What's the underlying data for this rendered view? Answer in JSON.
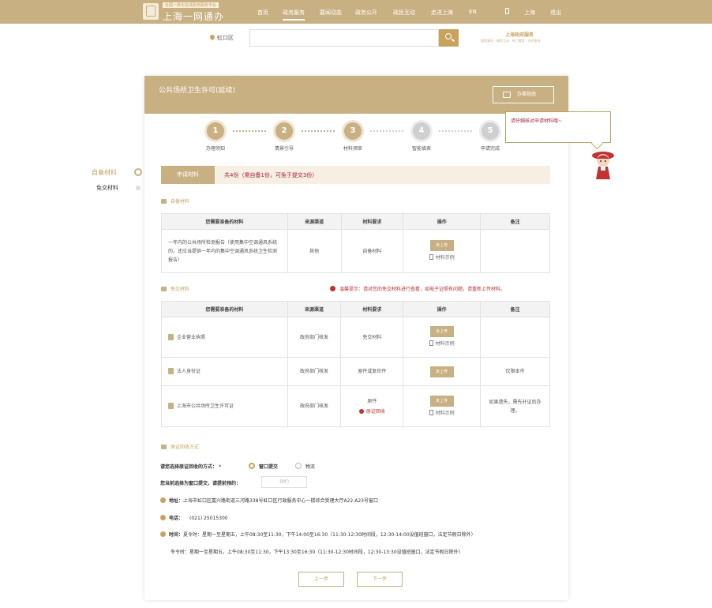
{
  "header": {
    "logo_sub": "全国一体化在线政务服务平台",
    "logo_title": "上海一网通办",
    "nav": [
      "首页",
      "政务服务",
      "要闻动态",
      "政务公开",
      "政民互动",
      "走进上海",
      "EN"
    ],
    "city": "上海",
    "exit": "退出"
  },
  "search": {
    "district": "虹口区",
    "placeholder": "",
    "brand_title": "上海政府服务",
    "brand_links": "搜索事项 · 政民互动 · 热门搜索 · 办件查询"
  },
  "page": {
    "title": "公共场所卫生许可(延续)",
    "guide_label": "办事指南"
  },
  "steps": [
    {
      "num": "1",
      "label": "办理须知",
      "active": true
    },
    {
      "num": "2",
      "label": "情景引导",
      "active": true
    },
    {
      "num": "3",
      "label": "材料预审",
      "active": true
    },
    {
      "num": "4",
      "label": "智能填表",
      "active": false
    },
    {
      "num": "5",
      "label": "申请完成",
      "active": false
    }
  ],
  "tooltip": "请仔细核对申请材料哦~",
  "side_nav": {
    "self": "自备材料",
    "free": "免交材料"
  },
  "tabs": {
    "active": "申请材料",
    "summary": "共4份（需自备1份，可免于提交3份）"
  },
  "self_section": {
    "title": "自备材料",
    "headers": [
      "您需要准备的材料",
      "来源渠道",
      "材料要求",
      "操作",
      "备注"
    ],
    "rows": [
      {
        "name": "一年内的公共场所检测报告（使用集中空调通风系统的，还应当提供一年内的集中空调通风系统卫生检测报告）",
        "source": "其他",
        "req": "自备材料",
        "upload": "未上传",
        "sample": "材料示例",
        "note": ""
      }
    ]
  },
  "free_section": {
    "title": "免交材料",
    "warning": "温馨提示：请对您的免交材料进行查看，如电子证照有问题，请重新上传材料。",
    "headers": [
      "您需要准备的材料",
      "来源渠道",
      "材料要求",
      "操作",
      "备注"
    ],
    "rows": [
      {
        "name": "企业营业执照",
        "source": "政府部门核发",
        "req": "免交材料",
        "upload": "未上传",
        "sample": "材料示例",
        "note": "",
        "recall": ""
      },
      {
        "name": "法人身份证",
        "source": "政府部门核发",
        "req": "原件或复印件",
        "upload": "未上传",
        "sample": "",
        "note": "仅限本市",
        "recall": ""
      },
      {
        "name": "上海市公共场所卫生许可证",
        "source": "政府部门核发",
        "req": "原件",
        "upload": "未上传",
        "sample": "材料示例",
        "note": "如果遗失，需先补证后办理。",
        "recall": "原证回收"
      }
    ]
  },
  "recall_section": {
    "title": "原证回收方式",
    "method_label": "请您选择原证回收的方式：",
    "required_mark": "*",
    "options": [
      "窗口提交",
      "物流"
    ],
    "reserve_label": "您当前选择为窗口提交，请提前预约：",
    "reserve_btn": "预约",
    "address_label": "地址：",
    "address": "上海市虹口区嘉兴路街道三河路338号虹口区行政服务中心一楼综合受理大厅A22-A23号窗口",
    "phone_label": "电话：",
    "phone": "(021) 25015300",
    "time_label": "时间：",
    "summer": "夏令时：星期一至星期五，上午08:30至11:30，下午14:00至16:30（11:30-12:30时间段，12:30-14:00设值班窗口，法定节假日除外）",
    "winter": "冬令时：星期一至星期五，上午08:30至11:30，下午13:30至16:30（11:30-12:30时间段，12:30-13:30设值班窗口，法定节假日除外）"
  },
  "footer": {
    "prev": "上一步",
    "next": "下一步"
  },
  "colors": {
    "gold": "#c9b083",
    "accent": "#c9a35b",
    "alert": "#c53030"
  }
}
